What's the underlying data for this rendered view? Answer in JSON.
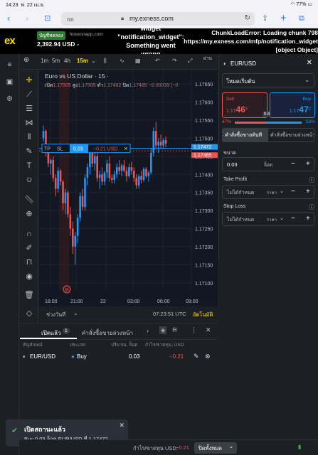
{
  "status": {
    "time": "14:23",
    "date": "พ. 22 เม.ย.",
    "battery": "77%"
  },
  "browser": {
    "aa": "กก",
    "url": "my.exness.com"
  },
  "account": {
    "badge": "บัญชีทดลอง",
    "server": "forexonapp.com",
    "balance": "2,392.94 USD"
  },
  "errors": {
    "widget_lines": [
      "widget",
      "\"notification_widget\":",
      "Something went",
      "wrong"
    ],
    "chunk_lines": [
      "ChunkLoadError: Loading chunk 798",
      "https://my.exness.com/mfp/notification_widget",
      "[object Object]"
    ]
  },
  "chart_toolbar": {
    "t1": "1m",
    "t2": "5m",
    "t3": "4h",
    "t4": "15m",
    "publish": "ผ่าน"
  },
  "chart": {
    "title": "Euro vs US Dollar · 15 ·",
    "ohlc": [
      {
        "k": "เปิด",
        "v": "1.17505"
      },
      {
        "k": "สูง",
        "v": "1.17505"
      },
      {
        "k": "ต่ำ",
        "v": "1.17482"
      },
      {
        "k": "ปิด",
        "v": "1.17485"
      },
      {
        "k": "",
        "v": "−0.00039 (−0"
      }
    ],
    "price_labels": [
      "1.17650",
      "1.17600",
      "1.17550",
      "1.17500",
      "1.17450",
      "1.17400",
      "1.17350",
      "1.17300",
      "1.17250",
      "1.17200",
      "1.17150",
      "1.17100"
    ],
    "ask_tag": "1.17472",
    "bid_tag": "1.17465",
    "time_labels": [
      "18:00",
      "21:00",
      "22",
      "03:00",
      "06:00",
      "09:00"
    ],
    "position_tag": {
      "tp": "TP",
      "sl": "SL",
      "lots": "0.03",
      "pl": "−0.21 USD",
      "x": "✕"
    },
    "event_marker": "M",
    "range_label": "ช่วงวันที่",
    "clock": "07:23:51 UTC",
    "auto": "อัตโนมัติ"
  },
  "panel": {
    "symbol": "EUR/USD",
    "order_mode": "โหมดเริ่มต้น",
    "sell_label": "Sell",
    "sell_price": "1.17",
    "sell_big": "46",
    "sell_sup": "5",
    "buy_label": "Buy",
    "buy_price": "1.17",
    "buy_big": "47",
    "buy_sup": "2",
    "spread": "0.8",
    "sell_pct": "47%",
    "buy_pct": "53%",
    "tab_market": "คำสั่งซื้อขายทันที",
    "tab_pending": "คำสั่งซื้อขายล่วงหน้า",
    "volume_label": "ขนาด",
    "volume_value": "0.03",
    "volume_unit": "ล็อต",
    "tp_label": "Take Profit",
    "tp_value": "ไม่ได้กำหนด",
    "tp_unit": "ราคา",
    "sl_label": "Stop Loss",
    "sl_value": "ไม่ได้กำหนด",
    "sl_unit": "ราคา"
  },
  "positions": {
    "tab_open": "เปิดแล้ว",
    "tab_open_count": "1",
    "tab_pending": "คำสั่งซื้อขายล่วงหน้า",
    "headers": {
      "symbol": "สัญลักษณ์",
      "type": "ประเภท",
      "volume": "ปริมาณ, ล็อต",
      "pl": "กำไร/ขาดทุน, USD"
    },
    "rows": [
      {
        "symbol": "EUR/USD",
        "type": "Buy",
        "volume": "0.03",
        "pl": "−0.21"
      }
    ]
  },
  "toast": {
    "title": "เปิดสถานะแล้ว",
    "body": "Buy 0.03 ล็อต EUR/USD ที่ 1.17472"
  },
  "footer": {
    "pl_label": "กำไร/ขาดทุน USD:",
    "pl_value": "−0.21",
    "close_all": "ปิดทั้งหมด"
  },
  "colors": {
    "up": "#2196f3",
    "down": "#ef5350",
    "accent": "#ffde02"
  },
  "candles": [
    [
      1.175,
      1.17535,
      1.1749,
      1.1752
    ],
    [
      1.1752,
      1.17525,
      1.1745,
      1.1746
    ],
    [
      1.1746,
      1.1747,
      1.1742,
      1.1743
    ],
    [
      1.1743,
      1.17445,
      1.174,
      1.1744
    ],
    [
      1.1744,
      1.1745,
      1.1738,
      1.1739
    ],
    [
      1.1739,
      1.174,
      1.1734,
      1.1736
    ],
    [
      1.1736,
      1.1742,
      1.1735,
      1.1741
    ],
    [
      1.1741,
      1.17415,
      1.1737,
      1.1738
    ],
    [
      1.1738,
      1.17385,
      1.173,
      1.1732
    ],
    [
      1.1732,
      1.1736,
      1.1729,
      1.1735
    ],
    [
      1.1735,
      1.17355,
      1.1728,
      1.1729
    ],
    [
      1.1729,
      1.1731,
      1.1723,
      1.1725
    ],
    [
      1.1725,
      1.1727,
      1.1718,
      1.172
    ],
    [
      1.172,
      1.1724,
      1.1715,
      1.1723
    ],
    [
      1.1723,
      1.1729,
      1.1721,
      1.1728
    ],
    [
      1.1728,
      1.1735,
      1.1727,
      1.1734
    ],
    [
      1.1734,
      1.1736,
      1.173,
      1.1731
    ],
    [
      1.1731,
      1.174,
      1.173,
      1.1739
    ],
    [
      1.1739,
      1.1743,
      1.1737,
      1.1742
    ],
    [
      1.1742,
      1.1747,
      1.174,
      1.1746
    ],
    [
      1.1746,
      1.1748,
      1.1742,
      1.1743
    ],
    [
      1.1743,
      1.1746,
      1.1741,
      1.1745
    ],
    [
      1.1745,
      1.1747,
      1.1738,
      1.1739
    ],
    [
      1.1739,
      1.1741,
      1.1736,
      1.174
    ],
    [
      1.174,
      1.1742,
      1.1737,
      1.1738
    ],
    [
      1.1738,
      1.1741,
      1.1737,
      1.17405
    ],
    [
      1.17405,
      1.1744,
      1.1739,
      1.1743
    ],
    [
      1.1743,
      1.1745,
      1.1738,
      1.1739
    ],
    [
      1.1739,
      1.174,
      1.17375,
      1.17385
    ],
    [
      1.17385,
      1.1741,
      1.17375,
      1.174
    ],
    [
      1.174,
      1.1743,
      1.1739,
      1.1742
    ],
    [
      1.1742,
      1.1744,
      1.174,
      1.1741
    ],
    [
      1.1741,
      1.1743,
      1.17395,
      1.17425
    ],
    [
      1.17425,
      1.1744,
      1.17405,
      1.1741
    ],
    [
      1.1741,
      1.1742,
      1.1738,
      1.17395
    ],
    [
      1.17395,
      1.1743,
      1.1739,
      1.1742
    ],
    [
      1.1742,
      1.17435,
      1.174,
      1.1741
    ],
    [
      1.1741,
      1.1742,
      1.1738,
      1.1739
    ],
    [
      1.1739,
      1.174,
      1.1736,
      1.1737
    ],
    [
      1.1737,
      1.174,
      1.1736,
      1.17395
    ],
    [
      1.17395,
      1.1741,
      1.17375,
      1.17385
    ],
    [
      1.17385,
      1.1742,
      1.1738,
      1.17415
    ],
    [
      1.17415,
      1.1742,
      1.1739,
      1.17395
    ],
    [
      1.17395,
      1.1741,
      1.1738,
      1.17405
    ],
    [
      1.17405,
      1.1747,
      1.174,
      1.1746
    ],
    [
      1.1746,
      1.1753,
      1.1745,
      1.1752
    ],
    [
      1.1752,
      1.17545,
      1.1747,
      1.1748
    ],
    [
      1.1748,
      1.175,
      1.1746,
      1.1749
    ],
    [
      1.1749,
      1.1751,
      1.1747,
      1.1748
    ],
    [
      1.1748,
      1.175,
      1.1747,
      1.17495
    ],
    [
      1.17495,
      1.17505,
      1.17475,
      1.17485
    ]
  ]
}
